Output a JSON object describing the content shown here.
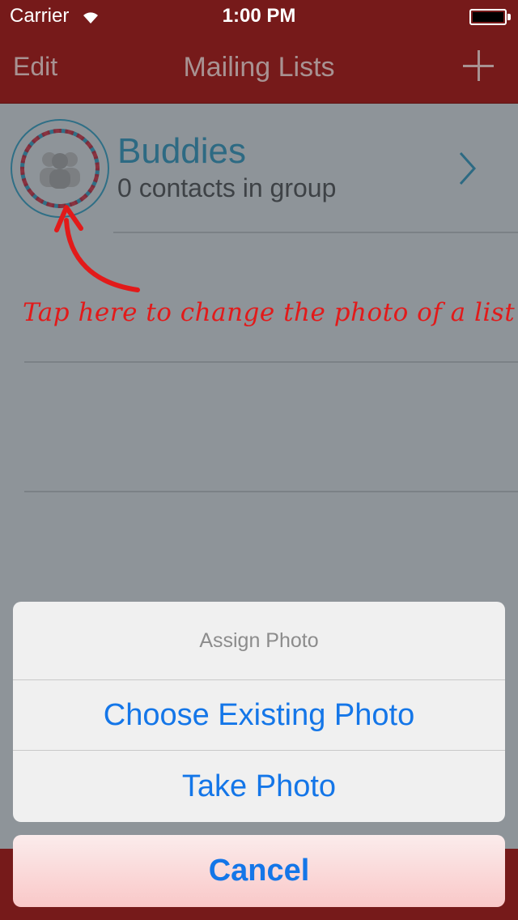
{
  "status": {
    "carrier": "Carrier",
    "time": "1:00 PM"
  },
  "nav": {
    "edit_label": "Edit",
    "title": "Mailing Lists",
    "add_icon": "plus-icon"
  },
  "list": {
    "rows": [
      {
        "name": "Buddies",
        "subtitle": "0 contacts in group"
      }
    ]
  },
  "annotation": {
    "text": "Tap here to change the photo of a list"
  },
  "action_sheet": {
    "title": "Assign Photo",
    "options": [
      "Choose Existing Photo",
      "Take Photo"
    ],
    "cancel_label": "Cancel"
  },
  "colors": {
    "nav_background": "#761a1a",
    "accent": "#1476e8",
    "list_text": "#2d6a83",
    "annotation": "#e21a1a"
  }
}
